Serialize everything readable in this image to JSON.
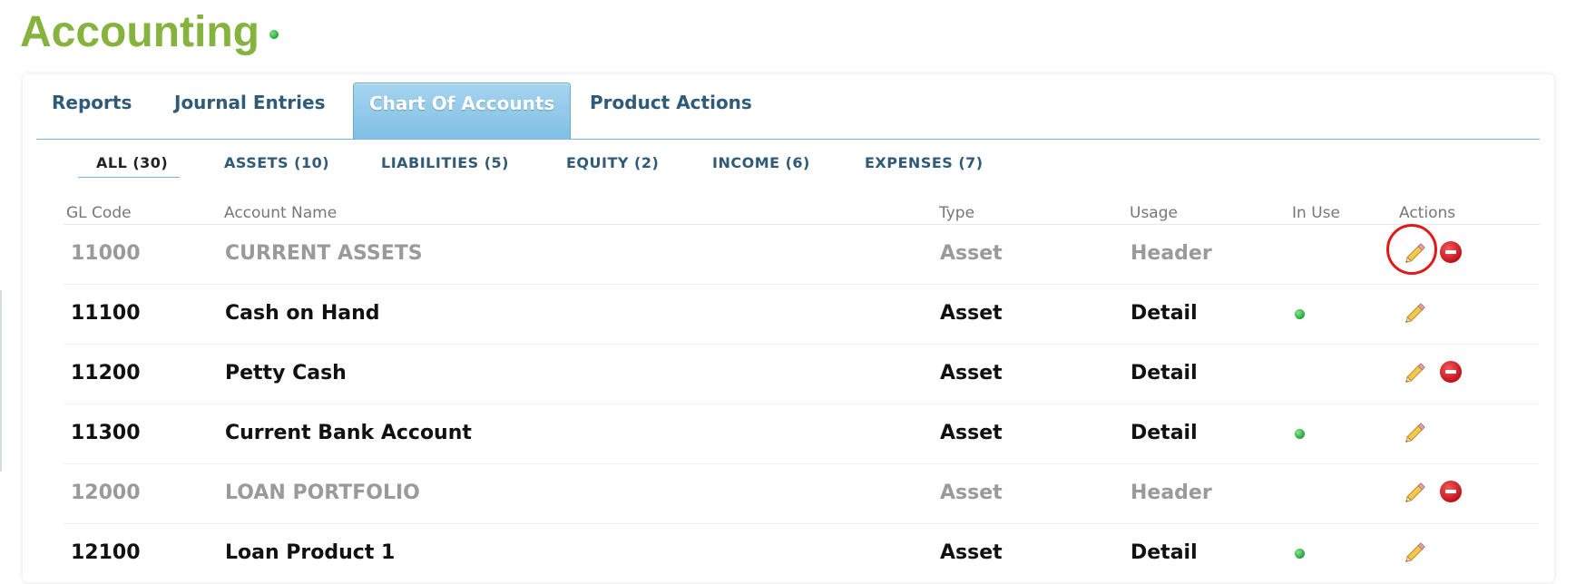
{
  "app": {
    "title": "Accounting"
  },
  "colors": {
    "title": "#86b33d",
    "tab_text": "#2f5a78",
    "active_tab": "#8fc8e8",
    "status_ok": "#22a83a",
    "delete": "#c0121b",
    "highlight": "#e01919"
  },
  "main_tabs": [
    {
      "label": "Reports",
      "active": false
    },
    {
      "label": "Journal Entries",
      "active": false
    },
    {
      "label": "Chart Of Accounts",
      "active": true
    },
    {
      "label": "Product Actions",
      "active": false
    }
  ],
  "filters": [
    {
      "label": "ALL (30)",
      "active": true
    },
    {
      "label": "ASSETS (10)",
      "active": false
    },
    {
      "label": "LIABILITIES (5)",
      "active": false
    },
    {
      "label": "EQUITY (2)",
      "active": false
    },
    {
      "label": "INCOME (6)",
      "active": false
    },
    {
      "label": "EXPENSES (7)",
      "active": false
    }
  ],
  "table": {
    "headers": [
      "GL Code",
      "Account Name",
      "Type",
      "Usage",
      "In Use",
      "Actions"
    ],
    "rows": [
      {
        "code": "11000",
        "name": "CURRENT ASSETS",
        "type": "Asset",
        "usage": "Header",
        "in_use": false,
        "deletable": true
      },
      {
        "code": "11100",
        "name": "Cash on Hand",
        "type": "Asset",
        "usage": "Detail",
        "in_use": true,
        "deletable": false
      },
      {
        "code": "11200",
        "name": "Petty Cash",
        "type": "Asset",
        "usage": "Detail",
        "in_use": false,
        "deletable": true
      },
      {
        "code": "11300",
        "name": "Current Bank Account",
        "type": "Asset",
        "usage": "Detail",
        "in_use": true,
        "deletable": false
      },
      {
        "code": "12000",
        "name": "LOAN PORTFOLIO",
        "type": "Asset",
        "usage": "Header",
        "in_use": false,
        "deletable": true
      },
      {
        "code": "12100",
        "name": "Loan Product 1",
        "type": "Asset",
        "usage": "Detail",
        "in_use": true,
        "deletable": false
      }
    ]
  }
}
